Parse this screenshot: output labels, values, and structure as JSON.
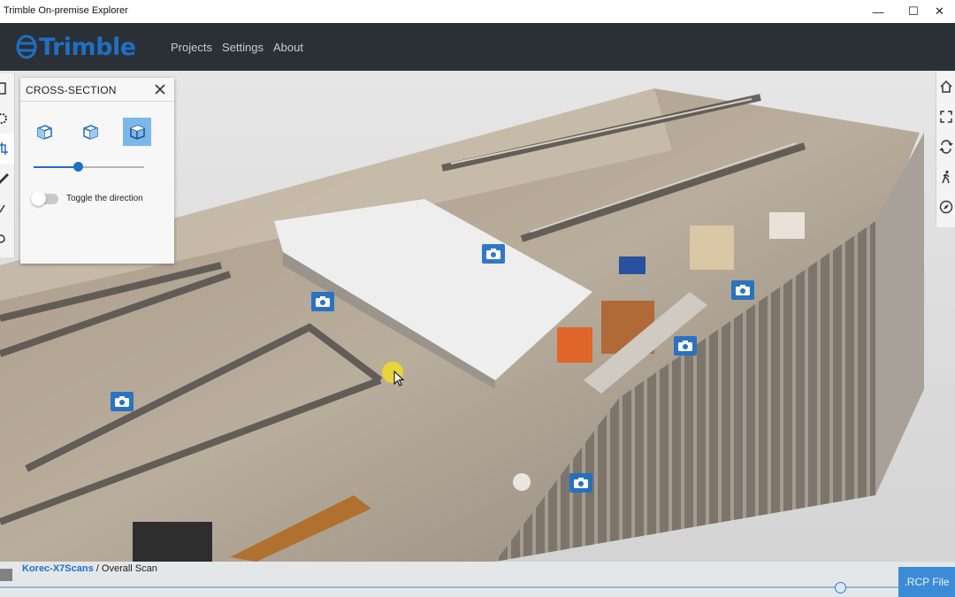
{
  "window": {
    "title": "Trimble On-premise Explorer",
    "controls": {
      "minimize": "—",
      "maximize": "☐",
      "close": "✕"
    }
  },
  "appbar": {
    "logo_text": "Trimble",
    "nav": [
      "Projects",
      "Settings",
      "About"
    ]
  },
  "cross_section": {
    "title": "CROSS-SECTION",
    "close_icon": "close-icon",
    "buttons": [
      "box-side-icon",
      "box-front-icon",
      "box-top-icon"
    ],
    "active_button": 2,
    "slider_fraction": 0.4,
    "toggle_label": "Toggle the direction",
    "toggle_on": false
  },
  "left_toolbar": [
    "layers-icon",
    "settings-icon",
    "crop-icon",
    "measure-icon",
    "edit-icon",
    "eye-icon"
  ],
  "right_toolbar": [
    "home-icon",
    "fit-view-icon",
    "orbit-icon",
    "walk-icon",
    "compass-icon"
  ],
  "breadcrumb": {
    "project": "Korec-X7Scans",
    "separator": " / ",
    "scan": "Overall Scan"
  },
  "timeline_fraction": 0.88,
  "rcp_button_label": ".RCP File",
  "colors": {
    "accent": "#1f6fc4",
    "appbar": "#2b3036",
    "panel_active": "#7cb7ea",
    "rcp_button": "#3b8bd7"
  }
}
